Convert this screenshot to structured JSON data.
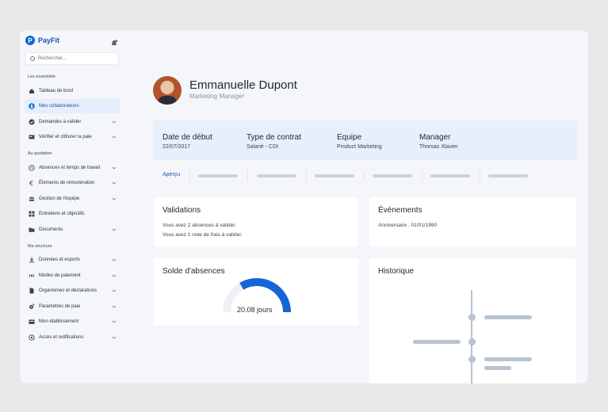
{
  "brand": {
    "name": "PayFit",
    "logo_letter": "P"
  },
  "search": {
    "placeholder": "Rechercher..."
  },
  "sidebar": {
    "sections": [
      {
        "title": "Les essentiels"
      },
      {
        "title": "Au quotidien"
      },
      {
        "title": "Ma structure"
      }
    ],
    "items": [
      {
        "label": "Tableau de bord",
        "icon": "home-icon",
        "chevron": false,
        "active": false
      },
      {
        "label": "Mes collaborateurs",
        "icon": "user-circle-icon",
        "chevron": false,
        "active": true
      },
      {
        "label": "Demandes à valider",
        "icon": "check-circle-icon",
        "chevron": true,
        "active": false
      },
      {
        "label": "Vérifier et clôturer la paie",
        "icon": "payslip-icon",
        "chevron": true,
        "active": false
      },
      {
        "label": "Absences et temps de travail",
        "icon": "clock-icon",
        "chevron": true,
        "active": false
      },
      {
        "label": "Éléments de rémunération",
        "icon": "euro-icon",
        "chevron": true,
        "active": false
      },
      {
        "label": "Gestion de l'équipe",
        "icon": "team-icon",
        "chevron": true,
        "active": false
      },
      {
        "label": "Entretiens et objectifs",
        "icon": "grid-icon",
        "chevron": false,
        "active": false
      },
      {
        "label": "Documents",
        "icon": "folder-icon",
        "chevron": true,
        "active": false
      },
      {
        "label": "Données et exports",
        "icon": "download-icon",
        "chevron": true,
        "active": false
      },
      {
        "label": "Modes de paiement",
        "icon": "wave-icon",
        "chevron": true,
        "active": false
      },
      {
        "label": "Organismes et déclarations",
        "icon": "file-icon",
        "chevron": true,
        "active": false
      },
      {
        "label": "Paramètres de paie",
        "icon": "gear-plus-icon",
        "chevron": true,
        "active": false
      },
      {
        "label": "Mon établissement",
        "icon": "building-icon",
        "chevron": true,
        "active": false
      },
      {
        "label": "Accès et notifications",
        "icon": "target-icon",
        "chevron": true,
        "active": false
      }
    ]
  },
  "profile": {
    "name": "Emmanuelle Dupont",
    "role": "Marketing Manager"
  },
  "info": [
    {
      "label": "Date de début",
      "value": "22/07/2017"
    },
    {
      "label": "Type de contrat",
      "value": "Salarié - CDI"
    },
    {
      "label": "Equipe",
      "value": "Product Marketing"
    },
    {
      "label": "Manager",
      "value": "Thomas Xlavier"
    }
  ],
  "tabs": {
    "active_label": "Aperçu"
  },
  "validations": {
    "title": "Validations",
    "lines": [
      "Vous avez 2 absences à valider.",
      "Vous avez 1 note de frais à valider."
    ]
  },
  "events": {
    "title": "Événements",
    "lines": [
      "Anniversaire : 01/01/1990"
    ]
  },
  "balance": {
    "title": "Solde d'absences",
    "value_label": "20.08 jours",
    "fill_fraction": 0.33,
    "accent": "#1565d8"
  },
  "history": {
    "title": "Historique"
  },
  "colors": {
    "accent": "#1565d8",
    "active_bg": "#e6eefb",
    "placeholder": "#b8c3d2"
  }
}
